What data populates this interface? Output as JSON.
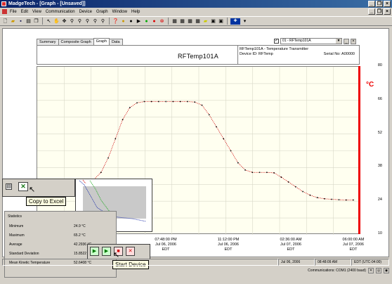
{
  "window": {
    "title": "MadgeTech - [Graph - [Unsaved]]",
    "controls": [
      "_",
      "❐",
      "×"
    ],
    "mdi_controls": [
      "_",
      "❐",
      "×"
    ]
  },
  "menubar": {
    "items": [
      "File",
      "Edit",
      "View",
      "Communication",
      "Device",
      "Graph",
      "Window",
      "Help"
    ]
  },
  "toolbar": {
    "buttons": [
      "new",
      "open",
      "save",
      "print",
      "copy",
      "cursor",
      "zoom",
      "pan",
      "zoom-in",
      "zoom-out",
      "help",
      "record",
      "stop",
      "play",
      "go",
      "record-red",
      "cancel",
      "grid1",
      "grid2",
      "grid3",
      "grid4",
      "grid5",
      "grid6",
      "flag"
    ]
  },
  "tabs": [
    {
      "label": "Summary",
      "active": false
    },
    {
      "label": "Composite Graph",
      "active": false
    },
    {
      "label": "Graph",
      "active": true
    },
    {
      "label": "Data",
      "active": false
    }
  ],
  "device_selector": {
    "checked": true,
    "value": "01 - RFTemp101A"
  },
  "header": {
    "title": "RFTemp101A",
    "line1": "RFTemp101A - Temperature Transmitter",
    "device_id_label": "Device ID: RFTemp",
    "serial_label": "Serial No: A00000"
  },
  "chart_data": {
    "type": "line",
    "unit": "°C",
    "y_ticks": [
      80,
      66,
      52,
      38,
      24,
      10
    ],
    "ylim": [
      10,
      80
    ],
    "x_ticks": [
      {
        "time": "07:48:00 PM",
        "date": "Jul 06, 2006",
        "tz": "EDT"
      },
      {
        "time": "11:12:00 PM",
        "date": "Jul 06, 2006",
        "tz": "EDT"
      },
      {
        "time": "02:36:00 AM",
        "date": "Jul 07, 2006",
        "tz": "EDT"
      },
      {
        "time": "06:00:00 AM",
        "date": "Jul 07, 2006",
        "tz": "EDT"
      }
    ],
    "series": [
      {
        "color": "#cc0000",
        "values": [
          32,
          32,
          33,
          36,
          42,
          50,
          58,
          63,
          65,
          65.5,
          65.5,
          65.5,
          65.5,
          65.5,
          65.5,
          65.5,
          65.3,
          64,
          60,
          55,
          50,
          45,
          40,
          37,
          36,
          36,
          36,
          35.8,
          34,
          32,
          30,
          28,
          26.5,
          25.5,
          25,
          24.8,
          24.6,
          24.5,
          24.5
        ]
      }
    ]
  },
  "copy_popup": {
    "tooltip": "Copy to Excel"
  },
  "statistics": {
    "title": "Statistics",
    "rows": [
      {
        "label": "Minimum",
        "value": "24.9 °C"
      },
      {
        "label": "Maximum",
        "value": "65.2 °C"
      },
      {
        "label": "Average",
        "value": "42.2936 °C"
      },
      {
        "label": "Standard Deviation",
        "value": "15.8522 °C"
      },
      {
        "label": "Mean Kinetic Temperature",
        "value": "52.6408 °C"
      }
    ]
  },
  "device_popup": {
    "tooltip": "Start Device"
  },
  "status": {
    "date": "Jul 06, 2006",
    "time": "08:48:09 AM",
    "zone": "EDT (UTC-04:00)",
    "communications": "Communications: COM1 (2400 baud)"
  },
  "colors": {
    "title_bar": "#0a246a",
    "plot_bg": "#fffff0",
    "series": "#cc0000",
    "unit_bar": "#e00000"
  }
}
